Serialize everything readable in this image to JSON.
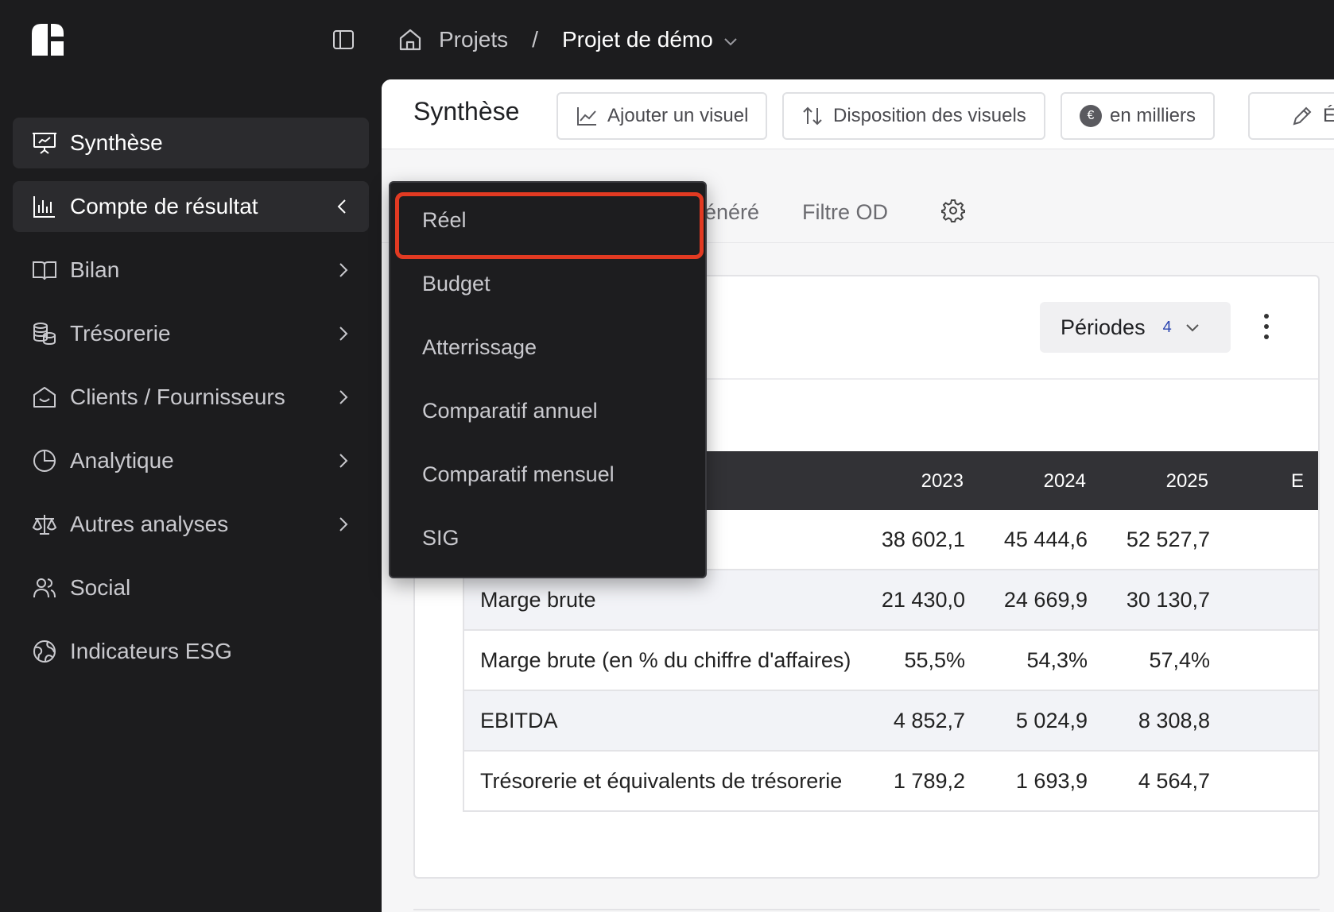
{
  "breadcrumb": {
    "projects": "Projets",
    "separator": "/",
    "current": "Projet de démo"
  },
  "sidebar": {
    "items": [
      {
        "label": "Synthèse",
        "icon": "presentation-icon",
        "active": true
      },
      {
        "label": "Compte de résultat",
        "icon": "bar-chart-icon",
        "expanded": true
      },
      {
        "label": "Bilan",
        "icon": "book-icon"
      },
      {
        "label": "Trésorerie",
        "icon": "coins-icon"
      },
      {
        "label": "Clients / Fournisseurs",
        "icon": "house-icon"
      },
      {
        "label": "Analytique",
        "icon": "pie-chart-icon"
      },
      {
        "label": "Autres analyses",
        "icon": "scale-icon"
      },
      {
        "label": "Social",
        "icon": "users-icon"
      },
      {
        "label": "Indicateurs ESG",
        "icon": "globe-icon"
      }
    ]
  },
  "main": {
    "title": "Synthèse",
    "toolbar": {
      "add_visual": "Ajouter un visuel",
      "layout": "Disposition des visuels",
      "currency_symbol": "€",
      "units": "en milliers",
      "edit_partial": "É"
    },
    "tabs": {
      "generated_partial": "énéré",
      "filter_od": "Filtre OD"
    },
    "periods": {
      "label": "Périodes",
      "count": "4"
    },
    "table": {
      "years": [
        "2023",
        "2024",
        "2025",
        "E"
      ],
      "rows": [
        {
          "label": "",
          "values": [
            "38 602,1",
            "45 444,6",
            "52 527,7"
          ]
        },
        {
          "label": "Marge brute",
          "values": [
            "21 430,0",
            "24 669,9",
            "30 130,7"
          ]
        },
        {
          "label": "Marge brute (en % du chiffre d'affaires)",
          "values": [
            "55,5%",
            "54,3%",
            "57,4%"
          ]
        },
        {
          "label": "EBITDA",
          "values": [
            "4 852,7",
            "5 024,9",
            "8 308,8"
          ]
        },
        {
          "label": "Trésorerie et équivalents de trésorerie",
          "values": [
            "1 789,2",
            "1 693,9",
            "4 564,7"
          ]
        }
      ]
    }
  },
  "dropdown": {
    "items": [
      "Réel",
      "Budget",
      "Atterrissage",
      "Comparatif annuel",
      "Comparatif mensuel",
      "SIG"
    ],
    "highlighted": "Réel"
  },
  "colors": {
    "highlight": "#e23a22",
    "periods_count": "#2b45b0"
  }
}
